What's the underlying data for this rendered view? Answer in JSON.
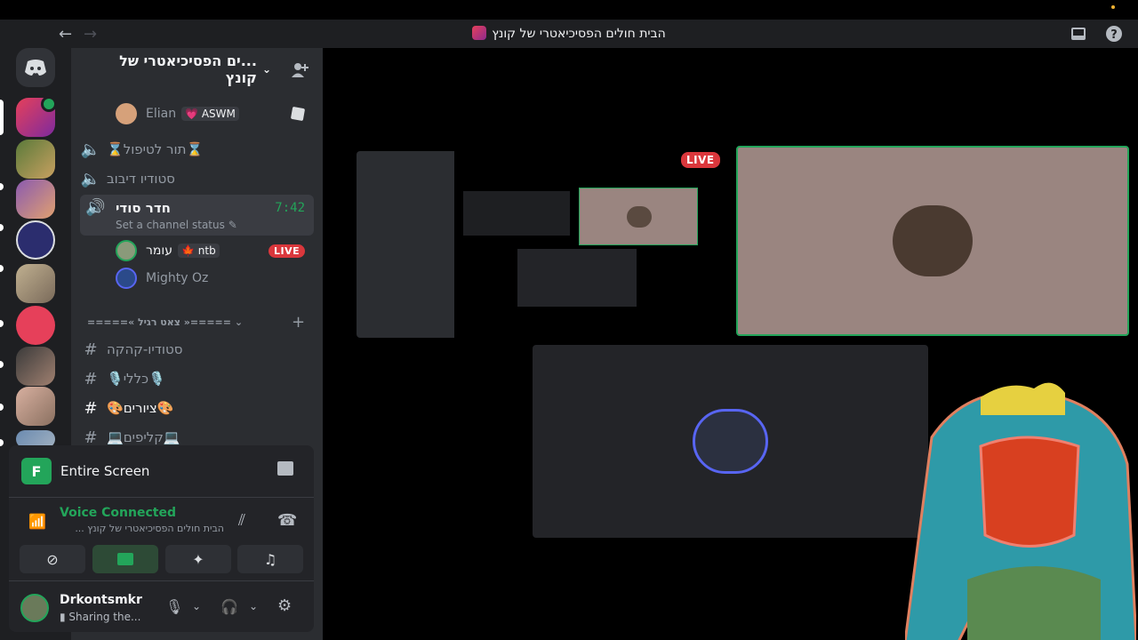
{
  "window": {
    "title": "הבית חולים הפסיכיאטרי של קונץ"
  },
  "guild": {
    "name": "...ים הפסיכיאטרי של קונץ"
  },
  "channels": {
    "top_user": {
      "name": "Elian",
      "tag": "ASWM"
    },
    "voice_queue": "⌛תור לטיפול⌛",
    "voice_studio": "סטודיו דיבוב",
    "voice_secret": {
      "name": "חדר סודי",
      "time": "7:42",
      "status": "Set a channel status"
    },
    "voice_users": [
      {
        "name": "עומר",
        "tag": "ntb",
        "badge": "LIVE"
      },
      {
        "name": "Mighty Oz"
      }
    ],
    "category": "=====« צאט רגיל »=====",
    "text": [
      "סטודיו-קהקה",
      "🎙️כללי🎙️",
      "🎨ציורים🎨",
      "💻קליפים💻"
    ]
  },
  "stream_bar": {
    "title": "Entire Screen",
    "icon_letter": "F"
  },
  "voice": {
    "status": "Voice Connected",
    "server": "הבית חולים הפסיכיאטרי של קונץ ..."
  },
  "user": {
    "name": "Drkontsmkr",
    "status": "Sharing the..."
  },
  "stage": {
    "live_badge": "LIVE"
  },
  "icons": [
    "back-arrow",
    "forward-arrow",
    "inbox-icon",
    "help-icon",
    "discord-icon",
    "add-member-icon",
    "speaker-icon",
    "hash-icon",
    "camera-off-icon",
    "screen-share-icon",
    "activities-icon",
    "soundboard-icon",
    "mic-icon",
    "headphones-icon",
    "settings-icon",
    "disconnect-icon",
    "signal-icon",
    "noise-icon"
  ],
  "colors": {
    "accent": "#23a55a",
    "live": "#da373c",
    "blurple": "#5865f2"
  }
}
